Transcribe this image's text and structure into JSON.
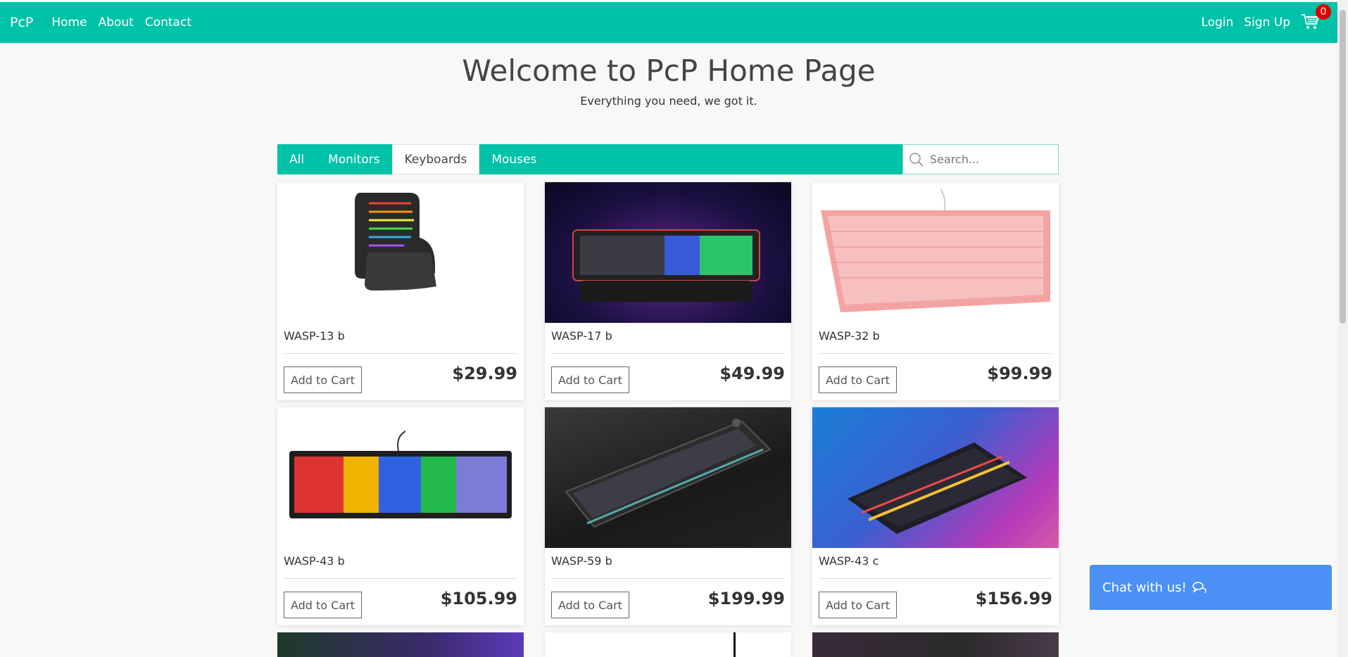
{
  "nav": {
    "brand": "PcP",
    "links": [
      "Home",
      "About",
      "Contact"
    ],
    "login": "Login",
    "signup": "Sign Up",
    "cart_count": "0"
  },
  "hero": {
    "title": "Welcome to PcP Home Page",
    "subtitle": "Everything you need, we got it."
  },
  "filters": {
    "tabs": [
      "All",
      "Monitors",
      "Keyboards",
      "Mouses"
    ],
    "active": "Keyboards",
    "search_placeholder": "Search..."
  },
  "products": [
    {
      "name": "WASP-13 b",
      "price": "$29.99",
      "button": "Add to Cart"
    },
    {
      "name": "WASP-17 b",
      "price": "$49.99",
      "button": "Add to Cart"
    },
    {
      "name": "WASP-32 b",
      "price": "$99.99",
      "button": "Add to Cart"
    },
    {
      "name": "WASP-43 b",
      "price": "$105.99",
      "button": "Add to Cart"
    },
    {
      "name": "WASP-59 b",
      "price": "$199.99",
      "button": "Add to Cart"
    },
    {
      "name": "WASP-43 c",
      "price": "$156.99",
      "button": "Add to Cart"
    }
  ],
  "chat": {
    "label": "Chat with us!"
  },
  "colors": {
    "accent": "#00c2a8",
    "chat": "#4a90f5",
    "badge": "#e00000"
  }
}
